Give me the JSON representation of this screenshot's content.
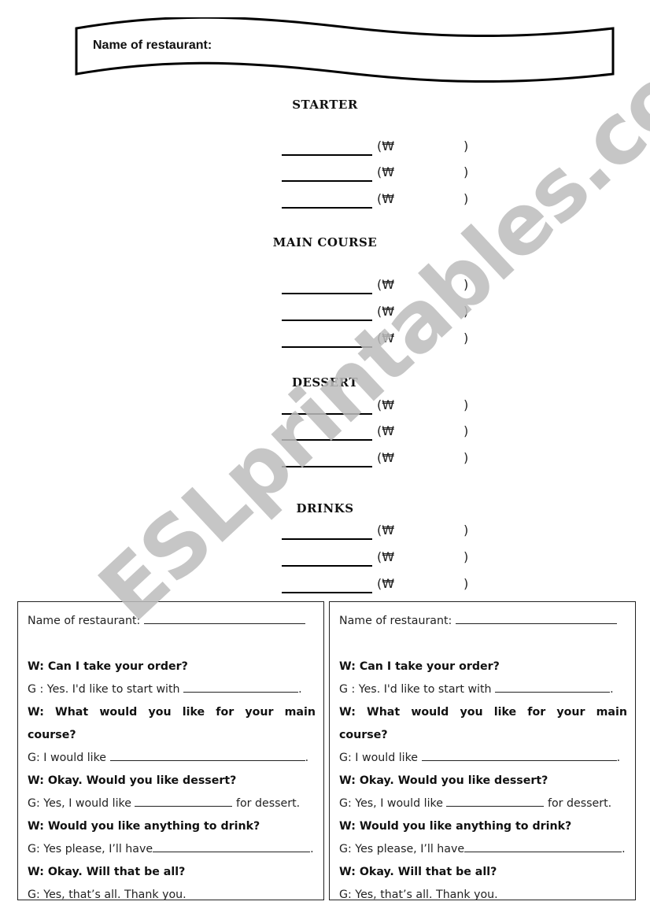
{
  "header": {
    "label": "Name of restaurant:"
  },
  "menu": {
    "currency_open": "(₩",
    "currency_close": ")",
    "sections": [
      {
        "title": "STARTER",
        "items": 3
      },
      {
        "title": "MAIN COURSE",
        "items": 3
      },
      {
        "title": "DESSERT",
        "items": 3
      },
      {
        "title": "DRINKS",
        "items": 3
      }
    ]
  },
  "watermark": "ESLprintables.com",
  "dialog": {
    "name_label": "Name of restaurant:",
    "w1": "W: Can I take your order?",
    "g1_prefix": "G : Yes. I'd like to start with",
    "g1_suffix": ".",
    "w2_words": [
      "W:",
      "What",
      "would",
      "you",
      "like",
      "for",
      "your",
      "main"
    ],
    "w2_cont": "course?",
    "g2_prefix": "G: I would like",
    "g2_suffix": ".",
    "w3": "W: Okay. Would you like dessert?",
    "g3_prefix": "G: Yes, I would like",
    "g3_suffix": "for dessert.",
    "w4": "W: Would you like anything to drink?",
    "g4_prefix": "G: Yes please, I’ll have",
    "g4_suffix": ".",
    "w5": "W: Okay. Will that be all?",
    "g5": "G: Yes, that’s all. Thank you."
  }
}
